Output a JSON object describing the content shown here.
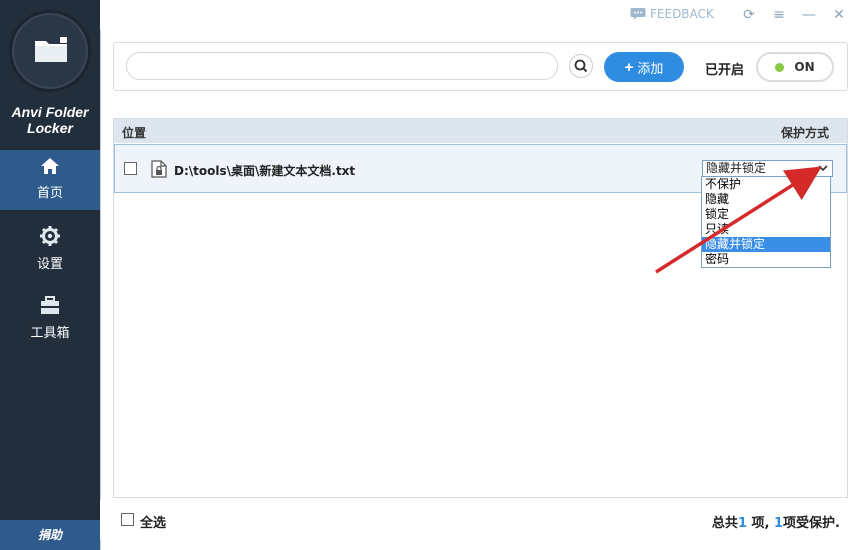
{
  "app": {
    "name_line1": "Anvi Folder",
    "name_line2": "Locker"
  },
  "titlebar": {
    "feedback_label": "FEEDBACK"
  },
  "sidebar": {
    "items": [
      {
        "label": "首页",
        "icon": "home-icon"
      },
      {
        "label": "设置",
        "icon": "gear-icon"
      },
      {
        "label": "工具箱",
        "icon": "toolbox-icon"
      }
    ],
    "donate_label": "捐助"
  },
  "search": {
    "value": "",
    "placeholder": ""
  },
  "toolbar": {
    "add_label": "添加",
    "status_label": "已开启",
    "toggle_label": "ON"
  },
  "table": {
    "columns": {
      "location": "位置",
      "protection": "保护方式"
    },
    "rows": [
      {
        "path": "D:\\tools\\桌面\\新建文本文档.txt",
        "protection": "隐藏并锁定"
      }
    ]
  },
  "dropdown": {
    "options": [
      "不保护",
      "隐藏",
      "锁定",
      "只读",
      "隐藏并锁定",
      "密码"
    ],
    "selected_index": 4
  },
  "footer": {
    "select_all_label": "全选",
    "summary_prefix": "总共",
    "total_count": "1",
    "summary_mid": "项,",
    "protected_count": "1",
    "summary_suffix": "项受保护."
  },
  "colors": {
    "accent": "#2e8de0",
    "sidebar_bg": "#232e3d",
    "active_nav": "#2f5b8c",
    "toggle_on": "#86c940",
    "arrow": "#d42a2a"
  }
}
